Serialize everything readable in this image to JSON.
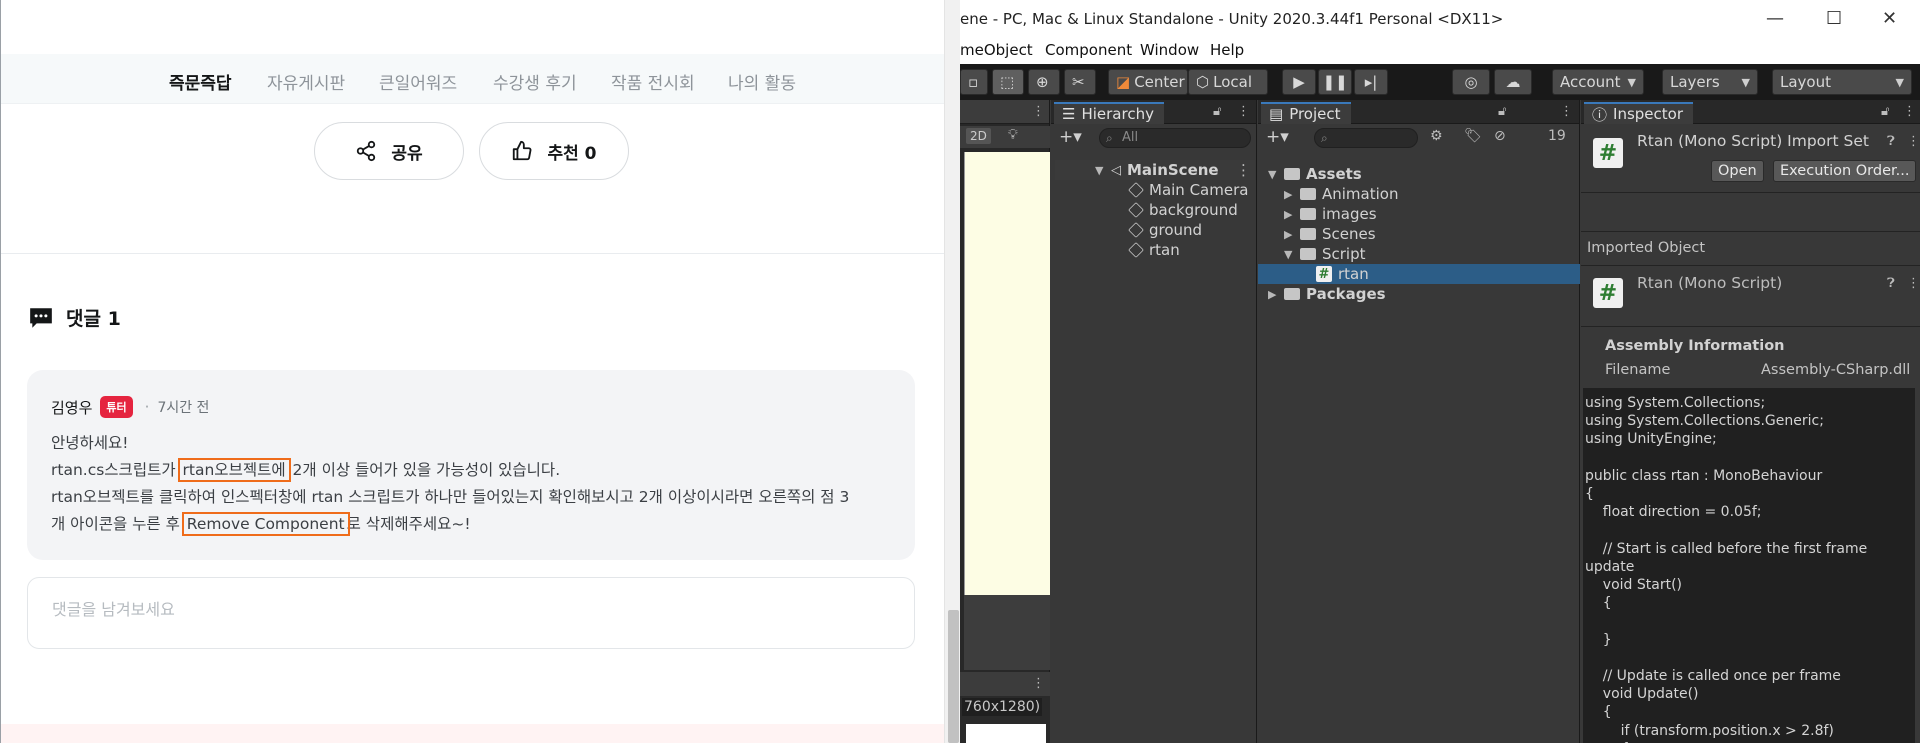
{
  "web": {
    "tabs": [
      "즉문즉답",
      "자유게시판",
      "큰일어워즈",
      "수강생 후기",
      "작품 전시회",
      "나의 활동"
    ],
    "share_label": "공유",
    "like_label": "추천 0",
    "comments_title": "댓글 1",
    "comment": {
      "author": "김영우",
      "badge": "튜터",
      "dot": "·",
      "time": "7시간 전",
      "line1": "안녕하세요!",
      "line2_a": "rtan.cs스크립트가 ",
      "line2_hl": "rtan오브젝트에",
      "line2_b": " 2개 이상 들어가 있을 가능성이 있습니다.",
      "line3": "rtan오브젝트를 클릭하여 인스펙터창에 rtan 스크립트가 하나만 들어있는지 확인해보시고 2개 이상이시라면 오른쪽의 점 3",
      "line4_a": "개 아이콘을 누른 후 ",
      "line4_hl": "Remove Component",
      "line4_b": "로 삭제해주세요~!"
    },
    "reply_placeholder": "댓글을 남겨보세요"
  },
  "unity": {
    "title": "ene - PC, Mac & Linux Standalone - Unity 2020.3.44f1 Personal <DX11>",
    "menu": [
      "meObject",
      "Component",
      "Window",
      "Help"
    ],
    "toolbar": {
      "center": "Center",
      "local": "Local",
      "account": "Account",
      "layers": "Layers",
      "layout": "Layout"
    },
    "scene": {
      "mode_2d": "2D",
      "game_res": "760x1280)"
    },
    "hierarchy": {
      "tab": "Hierarchy",
      "search": "All",
      "scene_name": "MainScene",
      "items": [
        "Main Camera",
        "background",
        "ground",
        "rtan"
      ]
    },
    "project": {
      "tab": "Project",
      "count": "19",
      "assets": "Assets",
      "folders": [
        "Animation",
        "images",
        "Scenes",
        "Script"
      ],
      "selected": "rtan",
      "packages": "Packages"
    },
    "inspector": {
      "tab": "Inspector",
      "title": "Rtan (Mono Script) Import Set",
      "open_btn": "Open",
      "exec_btn": "Execution Order...",
      "imported_object": "Imported Object",
      "object_title": "Rtan (Mono Script)",
      "assembly_info": "Assembly Information",
      "filename_label": "Filename",
      "filename_value": "Assembly-CSharp.dll",
      "code": "using System.Collections;\nusing System.Collections.Generic;\nusing UnityEngine;\n\npublic class rtan : MonoBehaviour\n{\n    float direction = 0.05f;\n\n    // Start is called before the first frame\nupdate\n    void Start()\n    {\n\n    }\n\n    // Update is called once per frame\n    void Update()\n    {\n        if (transform.position.x > 2.8f)\n        {"
    }
  }
}
